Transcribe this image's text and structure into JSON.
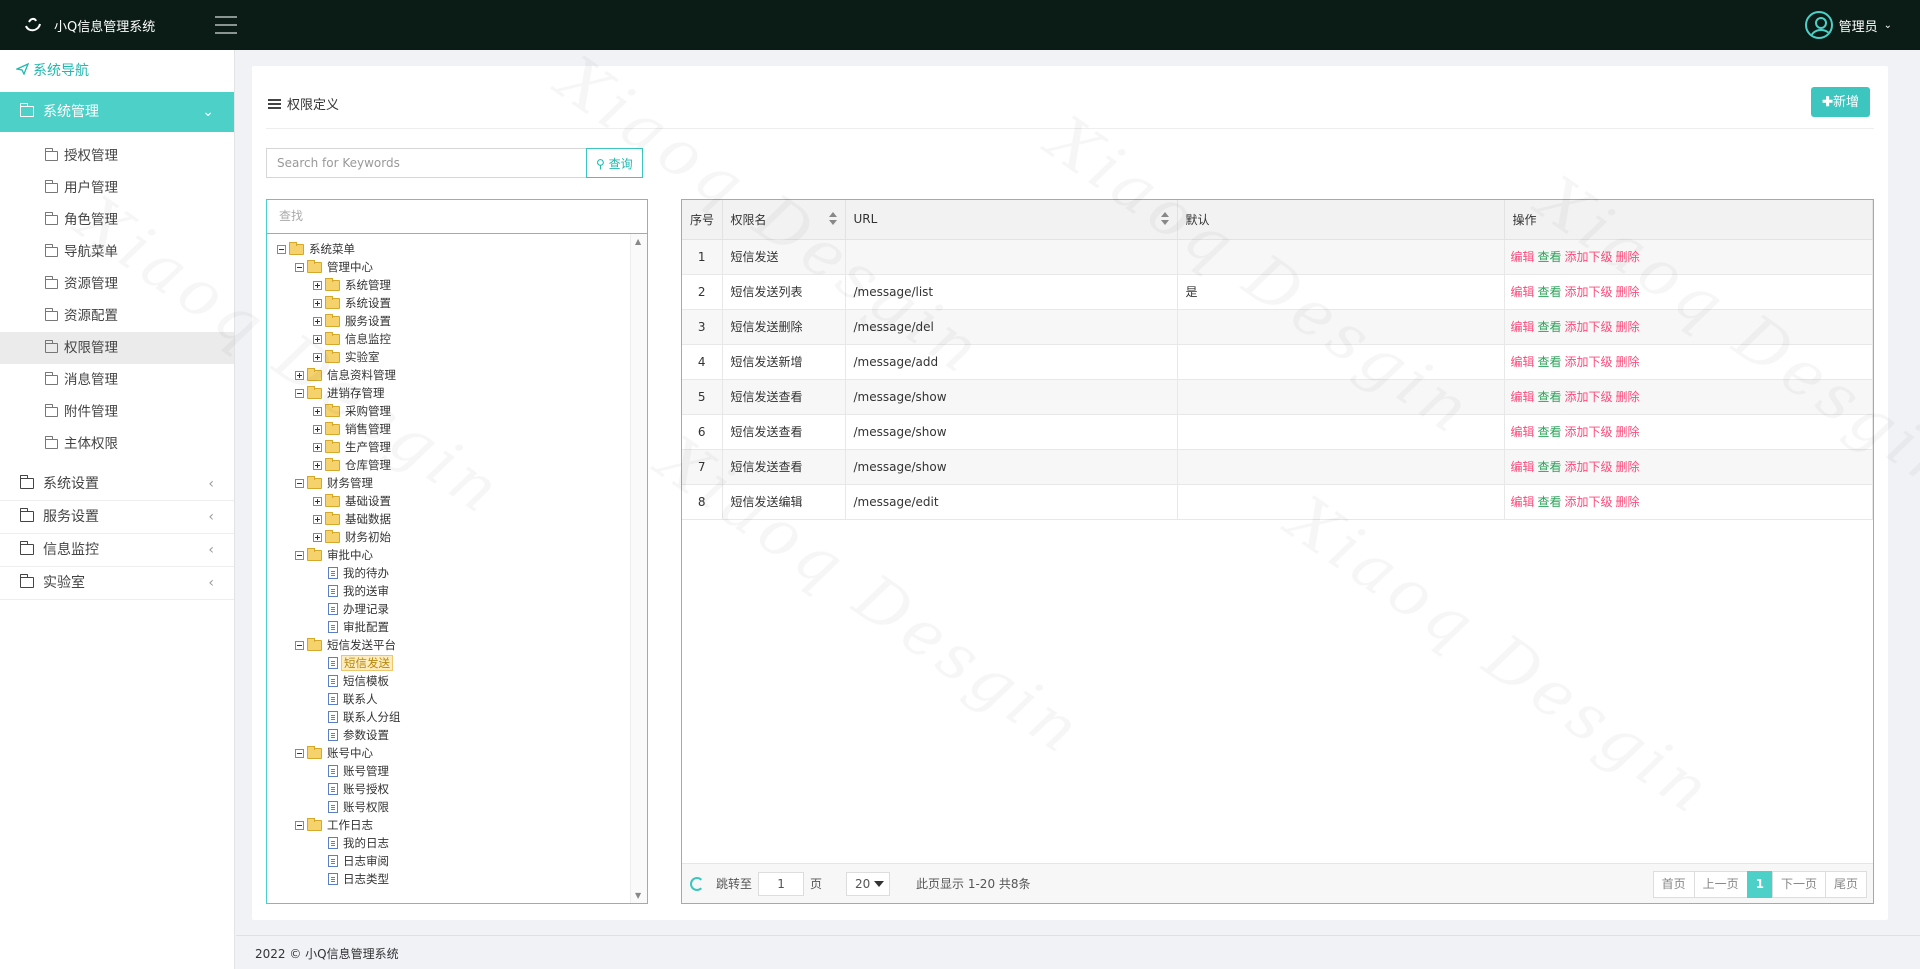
{
  "header": {
    "app_title": "小Q信息管理系统",
    "user_name": "管理员"
  },
  "sidebar": {
    "nav_title": "系统导航",
    "active_group": "系统管理",
    "sub_items": [
      "授权管理",
      "用户管理",
      "角色管理",
      "导航菜单",
      "资源管理",
      "资源配置",
      "权限管理",
      "消息管理",
      "附件管理",
      "主体权限"
    ],
    "active_sub": "权限管理",
    "groups": [
      "系统设置",
      "服务设置",
      "信息监控",
      "实验室"
    ]
  },
  "panel": {
    "title": "权限定义",
    "add_label": "新增"
  },
  "search": {
    "placeholder": "Search for Keywords",
    "button_label": "查询"
  },
  "tree": {
    "find_placeholder": "查找",
    "nodes": [
      {
        "label": "系统菜单",
        "level": 0,
        "kind": "folder",
        "toggle": "minus"
      },
      {
        "label": "管理中心",
        "level": 1,
        "kind": "folder",
        "toggle": "minus"
      },
      {
        "label": "系统管理",
        "level": 2,
        "kind": "folder",
        "toggle": "plus"
      },
      {
        "label": "系统设置",
        "level": 2,
        "kind": "folder",
        "toggle": "plus"
      },
      {
        "label": "服务设置",
        "level": 2,
        "kind": "folder",
        "toggle": "plus"
      },
      {
        "label": "信息监控",
        "level": 2,
        "kind": "folder",
        "toggle": "plus"
      },
      {
        "label": "实验室",
        "level": 2,
        "kind": "folder",
        "toggle": "plus"
      },
      {
        "label": "信息资料管理",
        "level": 1,
        "kind": "folder",
        "toggle": "plus"
      },
      {
        "label": "进销存管理",
        "level": 1,
        "kind": "folder",
        "toggle": "minus"
      },
      {
        "label": "采购管理",
        "level": 2,
        "kind": "folder",
        "toggle": "plus"
      },
      {
        "label": "销售管理",
        "level": 2,
        "kind": "folder",
        "toggle": "plus"
      },
      {
        "label": "生产管理",
        "level": 2,
        "kind": "folder",
        "toggle": "plus"
      },
      {
        "label": "仓库管理",
        "level": 2,
        "kind": "folder",
        "toggle": "plus"
      },
      {
        "label": "财务管理",
        "level": 1,
        "kind": "folder",
        "toggle": "minus"
      },
      {
        "label": "基础设置",
        "level": 2,
        "kind": "folder",
        "toggle": "plus"
      },
      {
        "label": "基础数据",
        "level": 2,
        "kind": "folder",
        "toggle": "plus"
      },
      {
        "label": "财务初始",
        "level": 2,
        "kind": "folder",
        "toggle": "plus"
      },
      {
        "label": "审批中心",
        "level": 1,
        "kind": "folder",
        "toggle": "minus"
      },
      {
        "label": "我的待办",
        "level": 2,
        "kind": "doc"
      },
      {
        "label": "我的送审",
        "level": 2,
        "kind": "doc"
      },
      {
        "label": "办理记录",
        "level": 2,
        "kind": "doc"
      },
      {
        "label": "审批配置",
        "level": 2,
        "kind": "doc"
      },
      {
        "label": "短信发送平台",
        "level": 1,
        "kind": "folder",
        "toggle": "minus"
      },
      {
        "label": "短信发送",
        "level": 2,
        "kind": "doc",
        "selected": true
      },
      {
        "label": "短信模板",
        "level": 2,
        "kind": "doc"
      },
      {
        "label": "联系人",
        "level": 2,
        "kind": "doc"
      },
      {
        "label": "联系人分组",
        "level": 2,
        "kind": "doc"
      },
      {
        "label": "参数设置",
        "level": 2,
        "kind": "doc"
      },
      {
        "label": "账号中心",
        "level": 1,
        "kind": "folder",
        "toggle": "minus"
      },
      {
        "label": "账号管理",
        "level": 2,
        "kind": "doc"
      },
      {
        "label": "账号授权",
        "level": 2,
        "kind": "doc"
      },
      {
        "label": "账号权限",
        "level": 2,
        "kind": "doc"
      },
      {
        "label": "工作日志",
        "level": 1,
        "kind": "folder",
        "toggle": "minus"
      },
      {
        "label": "我的日志",
        "level": 2,
        "kind": "doc"
      },
      {
        "label": "日志审阅",
        "level": 2,
        "kind": "doc"
      },
      {
        "label": "日志类型",
        "level": 2,
        "kind": "doc"
      }
    ]
  },
  "table": {
    "columns": [
      "序号",
      "权限名",
      "URL",
      "默认",
      "操作"
    ],
    "actions": [
      "编辑",
      "查看",
      "添加下级",
      "删除"
    ],
    "rows": [
      {
        "no": "1",
        "name": "短信发送",
        "url": "",
        "default": ""
      },
      {
        "no": "2",
        "name": "短信发送列表",
        "url": "/message/list",
        "default": "是"
      },
      {
        "no": "3",
        "name": "短信发送删除",
        "url": "/message/del",
        "default": ""
      },
      {
        "no": "4",
        "name": "短信发送新增",
        "url": "/message/add",
        "default": ""
      },
      {
        "no": "5",
        "name": "短信发送查看",
        "url": "/message/show",
        "default": ""
      },
      {
        "no": "6",
        "name": "短信发送查看",
        "url": "/message/show",
        "default": ""
      },
      {
        "no": "7",
        "name": "短信发送查看",
        "url": "/message/show",
        "default": ""
      },
      {
        "no": "8",
        "name": "短信发送编辑",
        "url": "/message/edit",
        "default": ""
      }
    ]
  },
  "pager": {
    "jump_label": "跳转至",
    "jump_value": "1",
    "page_unit": "页",
    "page_size": "20",
    "info": "此页显示 1-20 共8条",
    "first": "首页",
    "prev": "上一页",
    "current": "1",
    "next": "下一页",
    "last": "尾页"
  },
  "footer": {
    "text": "2022 © 小Q信息管理系统"
  },
  "watermark": "Xiaoq Desgin",
  "colors": {
    "accent": "#4dd0c8",
    "header_bg": "#0b1c17",
    "action_red": "#ff4a7a",
    "action_green": "#2ca35a"
  }
}
